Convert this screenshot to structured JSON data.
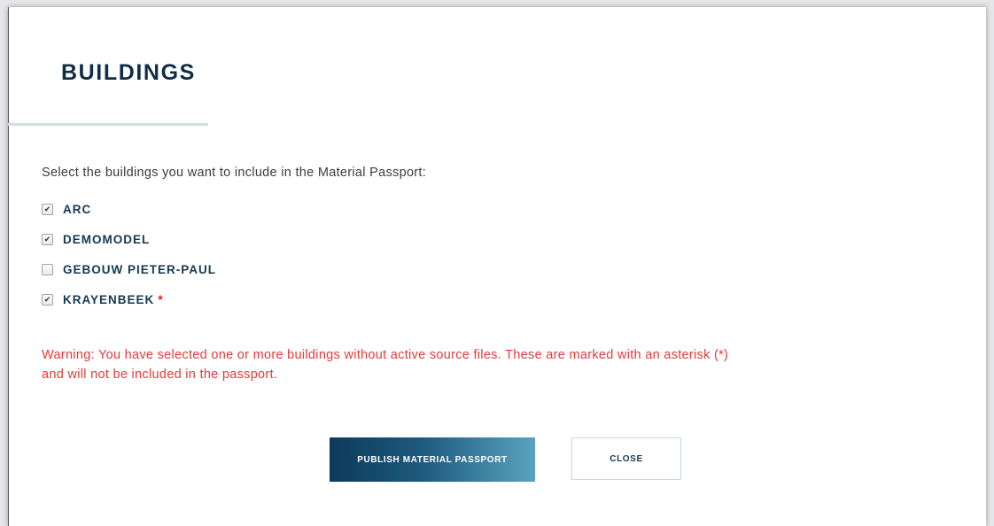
{
  "modal": {
    "title": "BUILDINGS",
    "instruction": "Select the buildings you want to include in the Material Passport:",
    "buildings": [
      {
        "name": "ARC",
        "checked": true,
        "asterisk": ""
      },
      {
        "name": "DEMOMODEL",
        "checked": true,
        "asterisk": ""
      },
      {
        "name": "GEBOUW PIETER-PAUL",
        "checked": false,
        "asterisk": ""
      },
      {
        "name": "KRAYENBEEK",
        "checked": true,
        "asterisk": "*"
      }
    ],
    "checkmark_glyph": "✔",
    "warning_line1": "Warning: You have selected one or more buildings without active source files. These are marked with an asterisk (*)",
    "warning_line2": "and will not be included in the passport.",
    "publish_label": "PUBLISH MATERIAL PASSPORT",
    "close_label": "CLOSE"
  },
  "colors": {
    "title": "#0f2d45",
    "warning": "#e53a3a",
    "asterisk": "#e02020",
    "primary_start": "#0d3a5a",
    "primary_end": "#5aa3c0"
  },
  "icons": {
    "checkbox_checked": "checkbox-checked-icon",
    "checkbox_unchecked": "checkbox-unchecked-icon"
  }
}
